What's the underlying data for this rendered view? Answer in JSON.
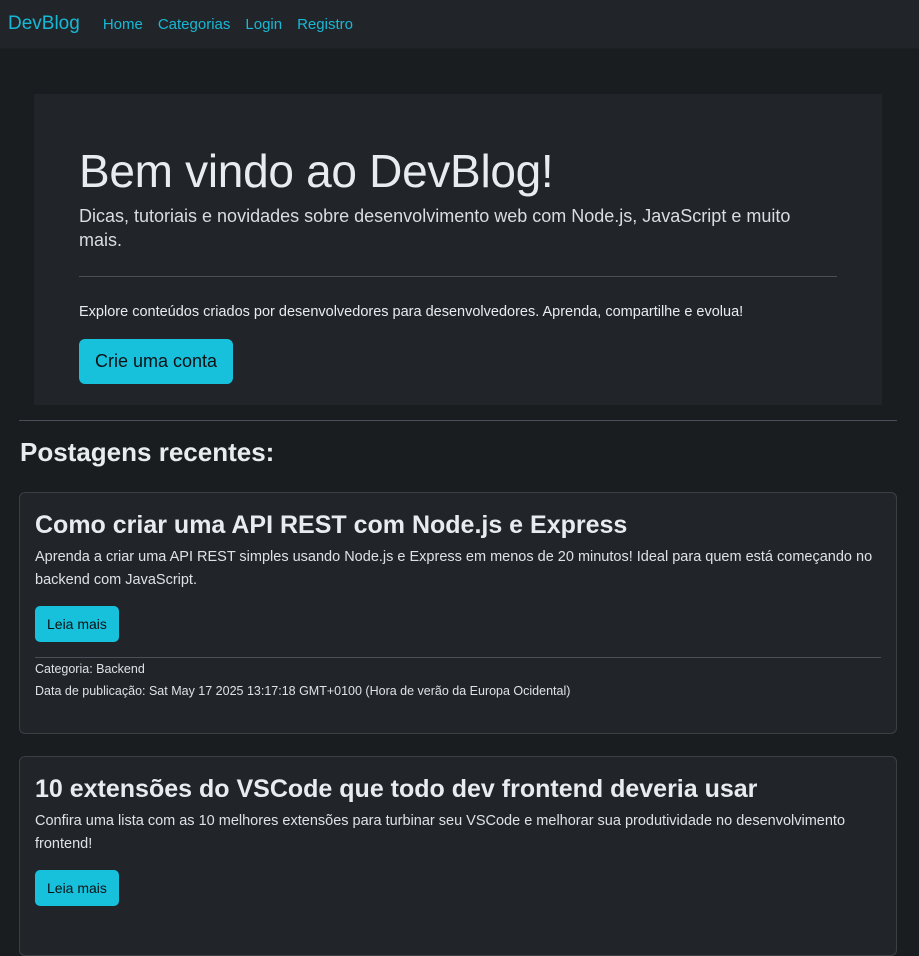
{
  "nav": {
    "brand": "DevBlog",
    "links": [
      "Home",
      "Categorias",
      "Login",
      "Registro"
    ]
  },
  "hero": {
    "title": "Bem vindo ao DevBlog!",
    "subtitle": "Dicas, tutoriais e novidades sobre desenvolvimento web com Node.js, JavaScript e muito mais.",
    "description": "Explore conteúdos criados por desenvolvedores para desenvolvedores. Aprenda, compartilhe e evolua!",
    "button": "Crie uma conta"
  },
  "recent": {
    "title": "Postagens recentes:",
    "posts": [
      {
        "title": "Como criar uma API REST com Node.js e Express",
        "text": "Aprenda a criar uma API REST simples usando Node.js e Express em menos de 20 minutos! Ideal para quem está começando no backend com JavaScript.",
        "button": "Leia mais",
        "category": "Categoria: Backend",
        "date": "Data de publicação: Sat May 17 2025 13:17:18 GMT+0100 (Hora de verão da Europa Ocidental)"
      },
      {
        "title": "10 extensões do VSCode que todo dev frontend deveria usar",
        "text": "Confira uma lista com as 10 melhores extensões para turbinar seu VSCode e melhorar sua produtividade no desenvolvimento frontend!",
        "button": "Leia mais"
      }
    ]
  },
  "colors": {
    "accent": "#17c1dc",
    "background": "#1a1d20",
    "surface": "#212529"
  }
}
